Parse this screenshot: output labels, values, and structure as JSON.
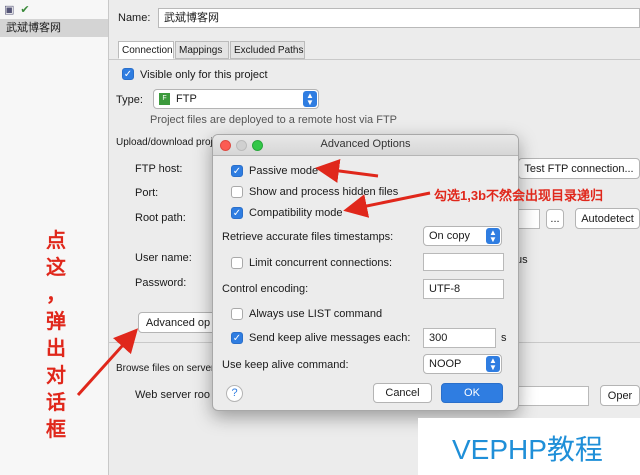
{
  "left_panel": {
    "selected_item": "武斌博客网"
  },
  "main": {
    "name_label": "Name:",
    "name_value": "武斌博客网",
    "tabs": [
      "Connection",
      "Mappings",
      "Excluded Paths"
    ],
    "visible_only_label": "Visible only for this project",
    "type_label": "Type:",
    "type_value": "FTP",
    "type_hint": "Project files are deployed to a remote host via FTP",
    "upload_label": "Upload/download proj",
    "ftp_host_label": "FTP host:",
    "port_label": "Port:",
    "root_path_label": "Root path:",
    "user_name_label": "User name:",
    "password_label": "Password:",
    "advanced_button": "Advanced op",
    "test_button": "Test FTP connection...",
    "autodetect_button": "Autodetect",
    "browse_button": "...",
    "us_fragment": "us",
    "browse_label": "Browse files on server",
    "web_server_label": "Web server roo",
    "open_button": "Oper"
  },
  "dialog": {
    "title": "Advanced Options",
    "passive_mode": "Passive mode",
    "show_hidden": "Show and process hidden files",
    "compat_mode": "Compatibility mode",
    "retrieve_label": "Retrieve accurate files timestamps:",
    "retrieve_value": "On copy",
    "limit_label": "Limit concurrent connections:",
    "encoding_label": "Control encoding:",
    "encoding_value": "UTF-8",
    "always_list": "Always use LIST command",
    "keepalive_label": "Send keep alive messages each:",
    "keepalive_value": "300",
    "keepalive_unit": "s",
    "keepalive_cmd_label": "Use keep alive command:",
    "keepalive_cmd_value": "NOOP",
    "help": "?",
    "cancel": "Cancel",
    "ok": "OK"
  },
  "annotations": {
    "right_note": "勾选1,3b不然会出现目录递归",
    "left_note": [
      "点",
      "这",
      "，",
      "弹",
      "出",
      "对",
      "话",
      "框"
    ],
    "watermark": "VEPHP教程"
  },
  "colors": {
    "accent": "#2f7de1",
    "annotation_red": "#e0271b",
    "watermark": "#1f8fd8"
  }
}
